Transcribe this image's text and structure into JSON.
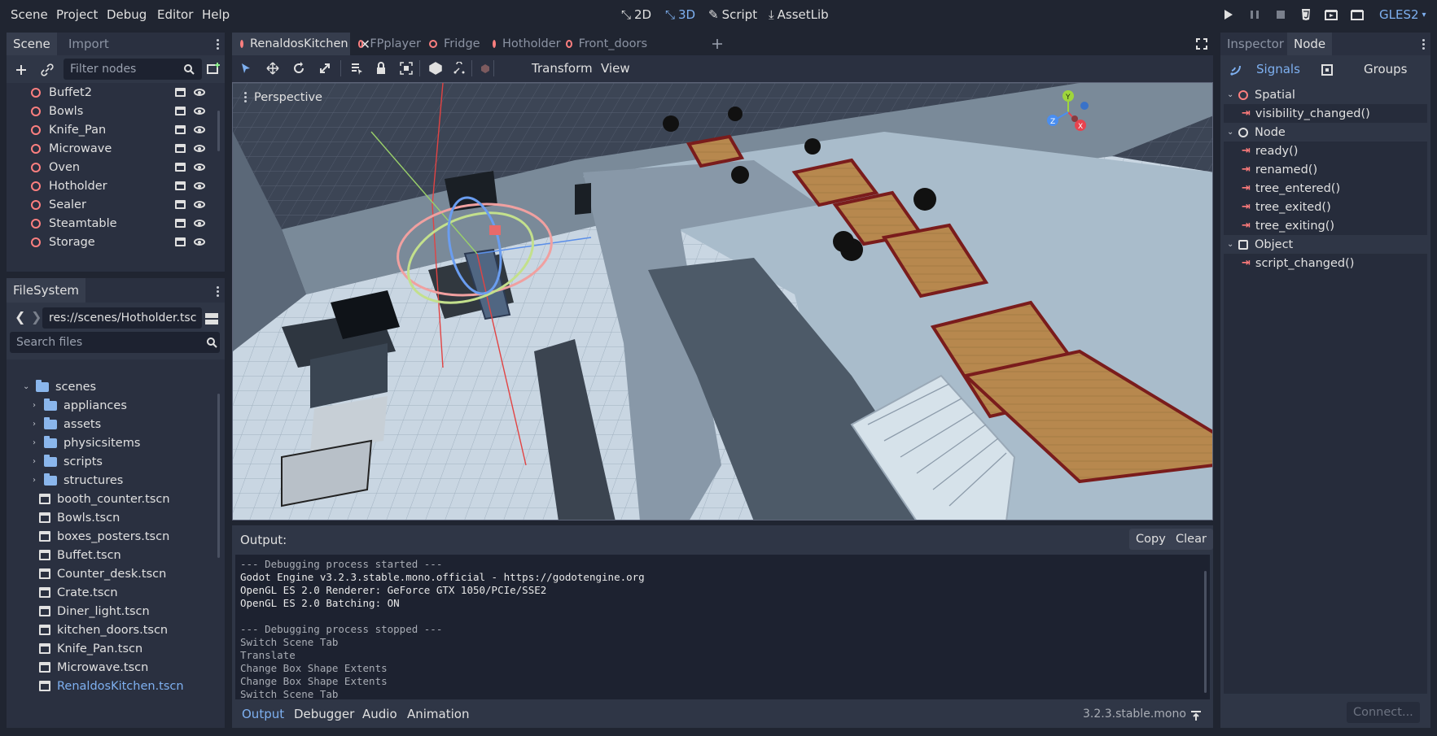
{
  "menubar": {
    "items": [
      "Scene",
      "Project",
      "Debug",
      "Editor",
      "Help"
    ],
    "modes": [
      {
        "label": "2D",
        "active": false
      },
      {
        "label": "3D",
        "active": true
      },
      {
        "label": "Script",
        "active": false
      },
      {
        "label": "AssetLib",
        "active": false
      }
    ],
    "renderer": "GLES2"
  },
  "scene_dock": {
    "tabs": [
      "Scene",
      "Import"
    ],
    "filter_placeholder": "Filter nodes",
    "nodes": [
      "Buffet2",
      "Bowls",
      "Knife_Pan",
      "Microwave",
      "Oven",
      "Hotholder",
      "Sealer",
      "Steamtable",
      "Storage"
    ]
  },
  "filesystem_dock": {
    "title": "FileSystem",
    "path": "res://scenes/Hotholder.tsc",
    "search_placeholder": "Search files",
    "root_folder": "scenes",
    "folders": [
      "appliances",
      "assets",
      "physicsitems",
      "scripts",
      "structures"
    ],
    "files": [
      "booth_counter.tscn",
      "Bowls.tscn",
      "boxes_posters.tscn",
      "Buffet.tscn",
      "Counter_desk.tscn",
      "Crate.tscn",
      "Diner_light.tscn",
      "kitchen_doors.tscn",
      "Knife_Pan.tscn",
      "Microwave.tscn",
      "RenaldosKitchen.tscn"
    ],
    "selected_file": "RenaldosKitchen.tscn"
  },
  "scene_tabs": [
    "RenaldosKitchen",
    "FPplayer",
    "Fridge",
    "Hotholder",
    "Front_doors"
  ],
  "viewport_toolbar": {
    "transform_label": "Transform",
    "view_label": "View"
  },
  "viewport": {
    "perspective_label": "Perspective",
    "gizmo_axes": [
      "Y",
      "Z",
      "X"
    ]
  },
  "output": {
    "title": "Output:",
    "copy_label": "Copy",
    "clear_label": "Clear",
    "lines": [
      {
        "text": "--- Debugging process started ---",
        "dim": true
      },
      {
        "text": "Godot Engine v3.2.3.stable.mono.official - https://godotengine.org",
        "dim": false
      },
      {
        "text": "OpenGL ES 2.0 Renderer: GeForce GTX 1050/PCIe/SSE2",
        "dim": false
      },
      {
        "text": "OpenGL ES 2.0 Batching: ON",
        "dim": false
      },
      {
        "text": "",
        "dim": false
      },
      {
        "text": "--- Debugging process stopped ---",
        "dim": true
      },
      {
        "text": "Switch Scene Tab",
        "dim": true
      },
      {
        "text": "Translate",
        "dim": true
      },
      {
        "text": "Change Box Shape Extents",
        "dim": true
      },
      {
        "text": "Change Box Shape Extents",
        "dim": true
      },
      {
        "text": "Switch Scene Tab",
        "dim": true
      }
    ],
    "bottom_tabs": [
      "Output",
      "Debugger",
      "Audio",
      "Animation"
    ],
    "version": "3.2.3.stable.mono"
  },
  "right_dock": {
    "tabs": [
      "Inspector",
      "Node"
    ],
    "subtabs": [
      "Signals",
      "Groups"
    ],
    "groups": [
      {
        "name": "Spatial",
        "signals": [
          "visibility_changed()"
        ]
      },
      {
        "name": "Node",
        "signals": [
          "ready()",
          "renamed()",
          "tree_entered()",
          "tree_exited()",
          "tree_exiting()"
        ]
      },
      {
        "name": "Object",
        "signals": [
          "script_changed()"
        ]
      }
    ],
    "connect_label": "Connect..."
  },
  "colors": {
    "accent": "#7eb0f0",
    "node_red": "#fc7f7f",
    "folder_blue": "#8ab6ec",
    "bg": "#202531",
    "panel": "#2a3040"
  }
}
